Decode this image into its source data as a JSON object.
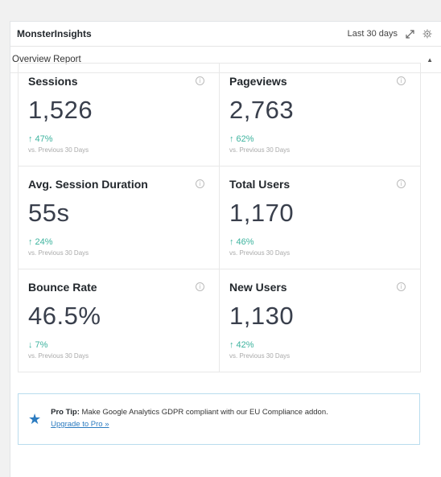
{
  "widget": {
    "title": "MonsterInsights",
    "date_range": "Last 30 days",
    "expand_icon": "expand-icon",
    "settings_icon": "gear-icon"
  },
  "report": {
    "name": "Overview Report",
    "toggle_icon": "caret-up-icon"
  },
  "metrics": [
    {
      "label": "Sessions",
      "value": "1,526",
      "arrow": "↑",
      "change": "47%",
      "direction": "up",
      "compare": "vs. Previous 30 Days"
    },
    {
      "label": "Pageviews",
      "value": "2,763",
      "arrow": "↑",
      "change": "62%",
      "direction": "up",
      "compare": "vs. Previous 30 Days"
    },
    {
      "label": "Avg. Session Duration",
      "value": "55s",
      "arrow": "↑",
      "change": "24%",
      "direction": "up",
      "compare": "vs. Previous 30 Days"
    },
    {
      "label": "Total Users",
      "value": "1,170",
      "arrow": "↑",
      "change": "46%",
      "direction": "up",
      "compare": "vs. Previous 30 Days"
    },
    {
      "label": "Bounce Rate",
      "value": "46.5%",
      "arrow": "↓",
      "change": "7%",
      "direction": "down",
      "compare": "vs. Previous 30 Days"
    },
    {
      "label": "New Users",
      "value": "1,130",
      "arrow": "↑",
      "change": "42%",
      "direction": "up",
      "compare": "vs. Previous 30 Days"
    }
  ],
  "tip": {
    "label": "Pro Tip:",
    "text": "Make Google Analytics GDPR compliant with our EU Compliance addon.",
    "link": "Upgrade to Pro »",
    "icon": "star-icon"
  },
  "colors": {
    "accent_green": "#3db39e",
    "link_blue": "#2b7bc0",
    "tip_border": "#b9dcee"
  }
}
